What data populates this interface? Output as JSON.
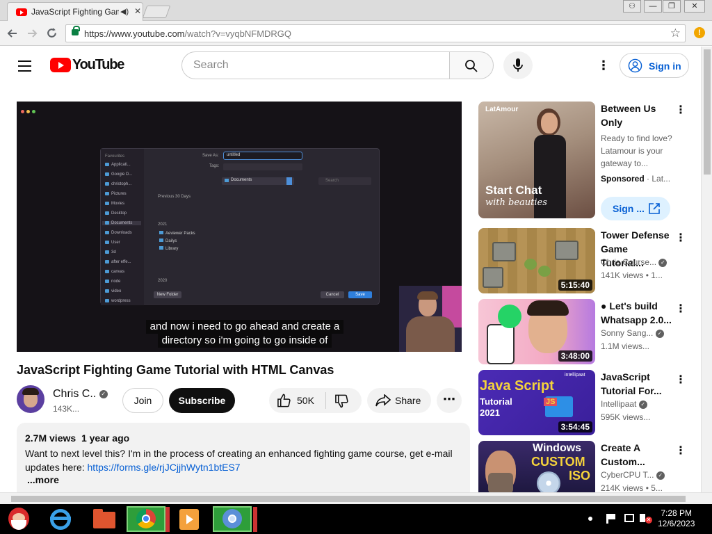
{
  "browser": {
    "tab_title": "JavaScript Fighting Game",
    "tab_audio_glyph": "◀)",
    "tab_close_glyph": "✕",
    "url_host": "https://www.youtube.com",
    "url_path": "/watch?v=vyqbNFMDRGQ",
    "window_buttons": [
      "⚇",
      "—",
      "❐",
      "✕"
    ]
  },
  "masthead": {
    "logo_text": "YouTube",
    "search_placeholder": "Search",
    "signin_label": "Sign in"
  },
  "player": {
    "caption_line1": "and now i need to go ahead and create a",
    "caption_line2": "directory so i'm going to go inside of",
    "dialog": {
      "save_as_label": "Save As:",
      "save_as_value": "untitled",
      "tags_label": "Tags:",
      "location": "Documents",
      "search_placeholder": "Search",
      "new_folder": "New Folder",
      "cancel": "Cancel",
      "save": "Save",
      "section_previous": "Previous 30 Days",
      "section_2021": "2021",
      "section_2020": "2020",
      "sidebar_label": "Favourites",
      "sidebar": [
        "Applicati...",
        "Google D...",
        "christoph...",
        "Pictures",
        "Movies",
        "Desktop",
        "Documents",
        "Downloads",
        "User",
        "3d",
        "after effe...",
        "canvas",
        "node",
        "video",
        "wordpress"
      ],
      "files": [
        "Aeviewer Packs",
        "Dailys",
        "Library"
      ]
    }
  },
  "video": {
    "title": "JavaScript Fighting Game Tutorial with HTML Canvas",
    "channel": "Chris C..",
    "subscribers": "143K...",
    "join_label": "Join",
    "subscribe_label": "Subscribe",
    "likes": "50K",
    "share_label": "Share"
  },
  "description": {
    "views": "2.7M views",
    "age": "1 year ago",
    "text": "Want to next level this? I'm in the process of creating an enhanced fighting game course, get e-mail updates here: ",
    "link": "https://forms.gle/rjJCjjhWytn1btES7",
    "more_label": "...more"
  },
  "sidebar": {
    "ad": {
      "title": "Between Us Only",
      "body": "Ready to find love? Latamour is your gateway to...",
      "sponsored": "Sponsored",
      "advertiser": "Lat...",
      "cta": "Sign ...",
      "thumb_brand": "LatAmour",
      "thumb_line1": "Start Chat",
      "thumb_line2": "with beauties"
    },
    "items": [
      {
        "title": "Tower Defense Game Tutorial...",
        "channel": "Chris Course...",
        "meta": "141K views",
        "meta2": "1...",
        "duration": "5:15:40"
      },
      {
        "title": "● Let's build Whatsapp 2.0...",
        "channel": "Sonny Sang...",
        "meta": "1.1M views...",
        "meta2": "",
        "duration": "3:48:00"
      },
      {
        "title": "JavaScript Tutorial For...",
        "channel": "Intellipaat",
        "meta": "595K views...",
        "meta2": "",
        "duration": "3:54:45",
        "thumb_line1": "Java Script",
        "thumb_line2": "Tutorial",
        "thumb_line3": "2021",
        "thumb_brand": "intellipaat",
        "thumb_badge": "JS"
      },
      {
        "title": "Create A Custom...",
        "channel": "CyberCPU T...",
        "meta": "214K views",
        "meta2": "5...",
        "duration": "",
        "thumb_line1": "Windows",
        "thumb_line2": "CUSTOM",
        "thumb_line3": "ISO"
      }
    ]
  },
  "taskbar": {
    "time": "7:28 PM",
    "date": "12/6/2023"
  },
  "colors": {
    "youtube_red": "#ff0000",
    "link_blue": "#065fd4",
    "taskbar_active": "#2e9e3a"
  }
}
